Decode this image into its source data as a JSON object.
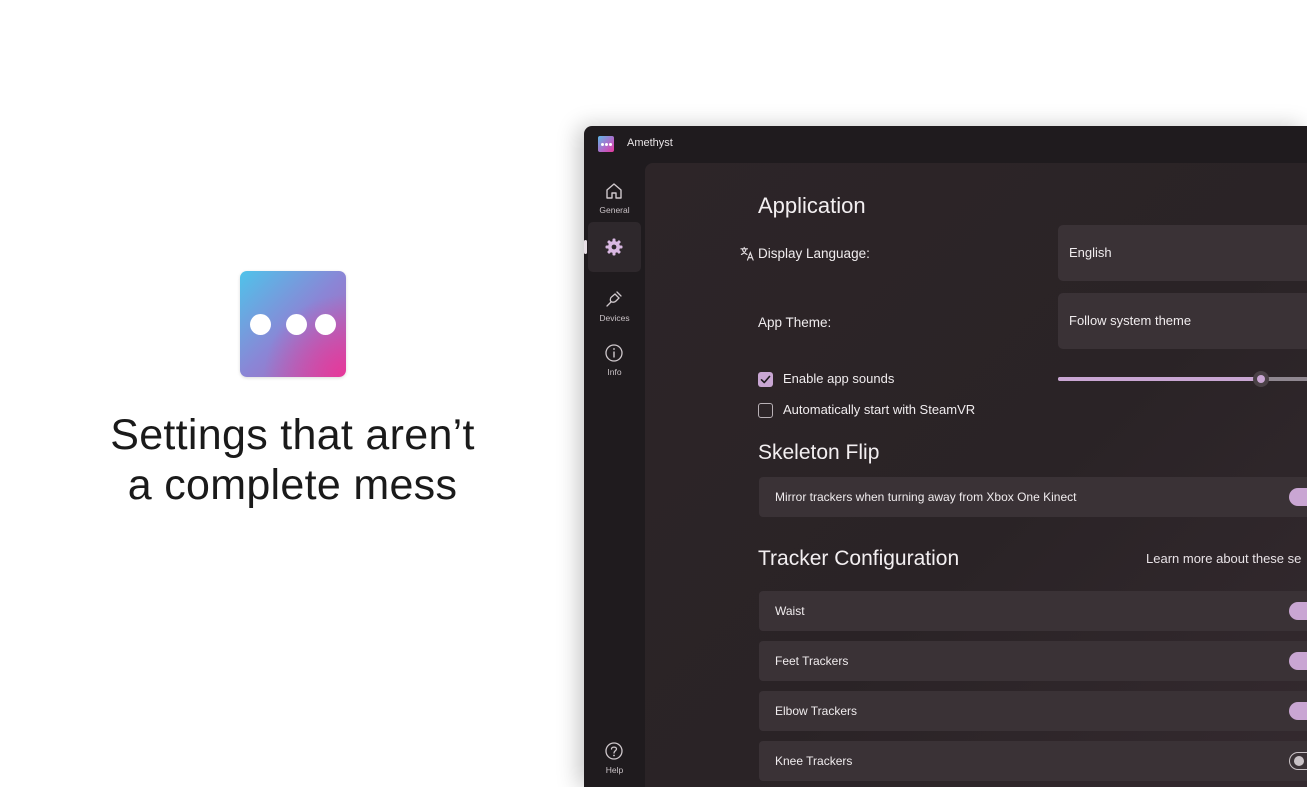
{
  "promo": {
    "tagline_line1": "Settings that aren’t",
    "tagline_line2": "a complete mess"
  },
  "window": {
    "title": "Amethyst",
    "icon": "amethyst-logo-icon"
  },
  "nav": {
    "items": [
      {
        "label": "General",
        "icon": "home-icon"
      },
      {
        "label": "",
        "icon": "gear-icon",
        "active": true
      },
      {
        "label": "Devices",
        "icon": "plug-icon"
      },
      {
        "label": "Info",
        "icon": "info-icon"
      },
      {
        "label": "Help",
        "icon": "help-icon"
      }
    ]
  },
  "application": {
    "heading": "Application",
    "display_language_label": "Display Language:",
    "display_language_value": "English",
    "app_theme_label": "App Theme:",
    "app_theme_value": "Follow system theme",
    "enable_sounds_label": "Enable app sounds",
    "enable_sounds_checked": true,
    "sound_volume_fraction": 0.81,
    "autostart_label": "Automatically start with SteamVR",
    "autostart_checked": false
  },
  "skeleton_flip": {
    "heading": "Skeleton Flip",
    "mirror_label": "Mirror trackers when turning away from Xbox One Kinect",
    "mirror_on": true
  },
  "tracker_config": {
    "heading": "Tracker Configuration",
    "learn_more": "Learn more about these se",
    "trackers": [
      {
        "label": "Waist",
        "on": true
      },
      {
        "label": "Feet Trackers",
        "on": true
      },
      {
        "label": "Elbow Trackers",
        "on": true
      },
      {
        "label": "Knee Trackers",
        "on": false
      }
    ]
  },
  "colors": {
    "accent": "#c9a6d3",
    "window_bg": "#1f1b1e",
    "card_bg": "#3a3236"
  }
}
